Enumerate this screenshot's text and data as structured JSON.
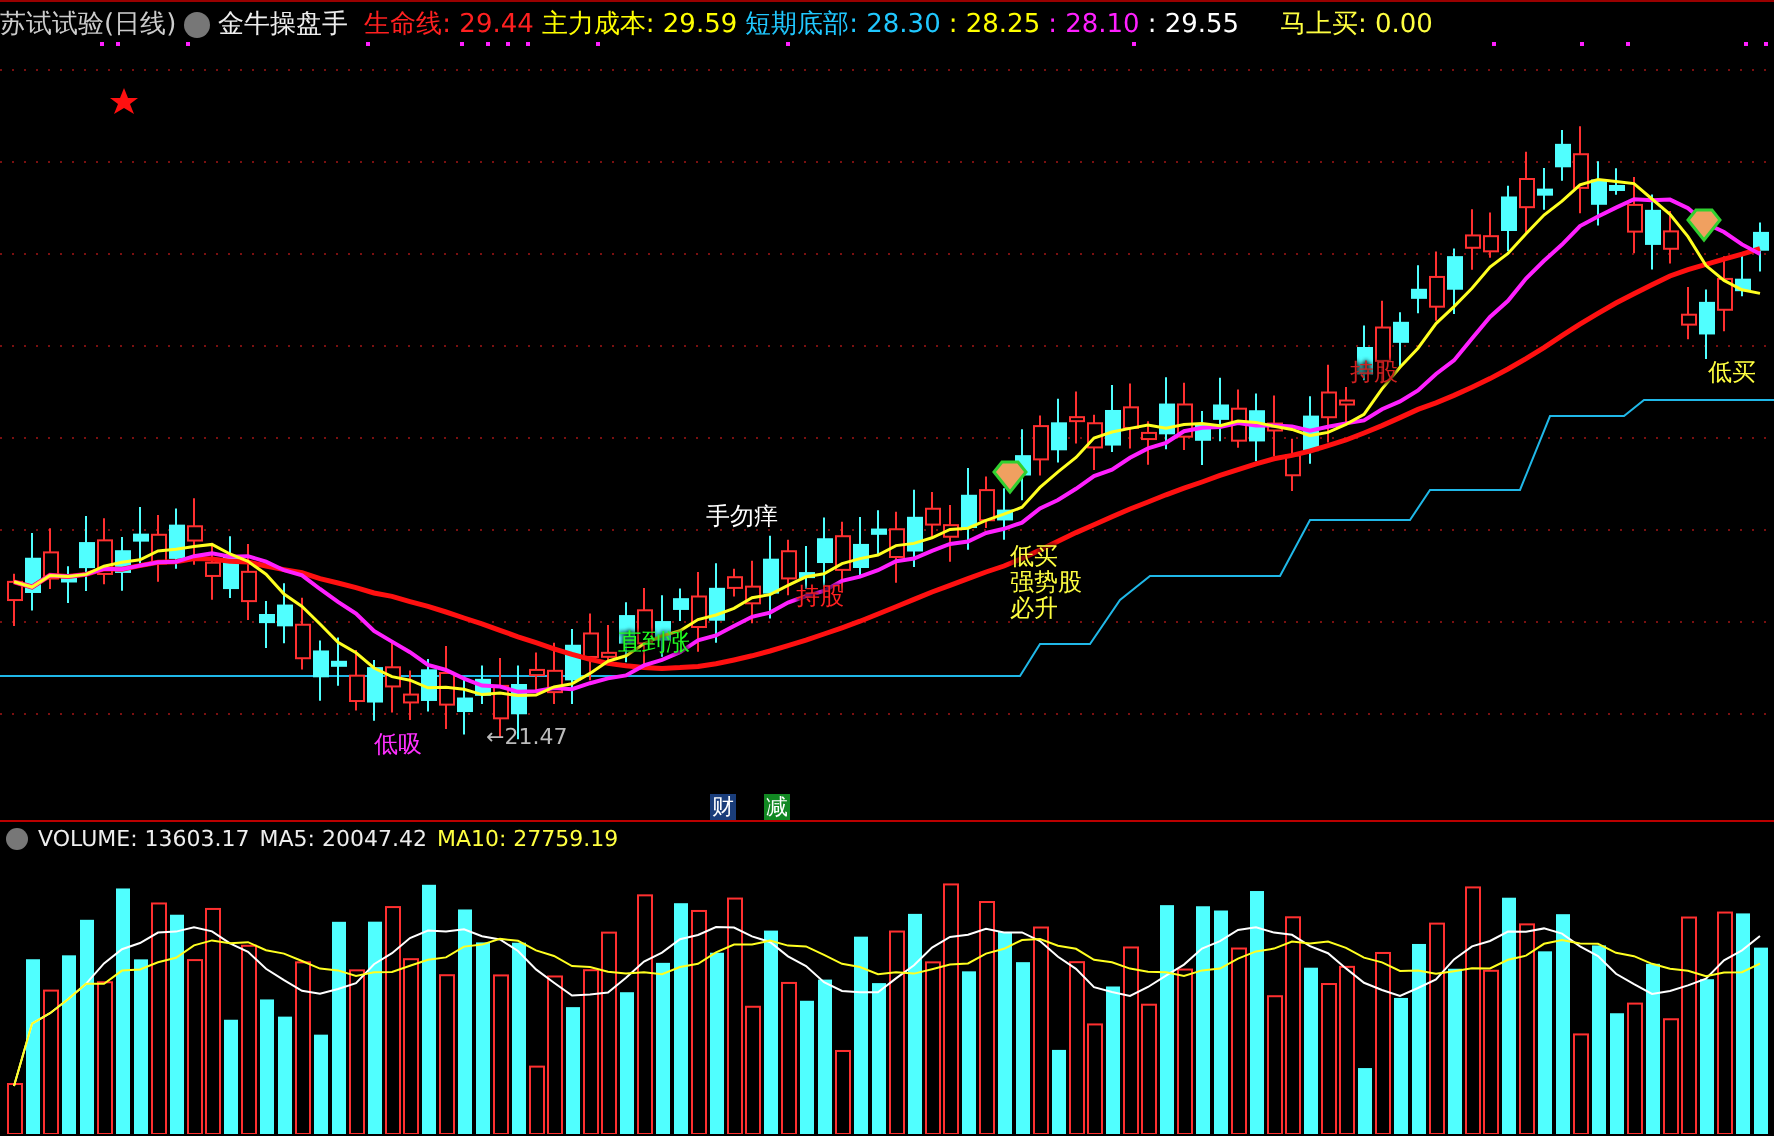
{
  "header": {
    "stock": "苏试试验(日线)",
    "indicator_name": "金牛操盘手",
    "values": [
      {
        "text": "生命线: 29.44",
        "color": "#ff2020"
      },
      {
        "text": "主力成本: 29.59",
        "color": "#ffff00"
      },
      {
        "text": "短期底部: 28.30",
        "color": "#20c8ff"
      },
      {
        "text": ": 28.25",
        "color": "#ffff00"
      },
      {
        "text": ": 28.10",
        "color": "#ff20ff"
      },
      {
        "text": ": 29.55",
        "color": "#ffffff"
      }
    ],
    "buy_now": "马上买: 0.00"
  },
  "annotations": [
    {
      "lines": [
        "手勿痒"
      ],
      "color": "#ffffff"
    },
    {
      "lines": [
        "持股"
      ],
      "color": "#ff2020"
    },
    {
      "lines": [
        "直到涨"
      ],
      "color": "#20ff20"
    },
    {
      "lines": [
        "低吸"
      ],
      "color": "#ff30ff"
    },
    {
      "lines": [
        "低买",
        "强势股",
        "必升"
      ],
      "color": "#ffff40"
    },
    {
      "lines": [
        "持股"
      ],
      "color": "#d02020"
    },
    {
      "lines": [
        "低买"
      ],
      "color": "#ffff40"
    }
  ],
  "low_marker": "←21.47",
  "badges": [
    {
      "text": "财",
      "color": "#1a3d7a"
    },
    {
      "text": "减",
      "color": "#118822"
    }
  ],
  "volume": {
    "label": "VOLUME: 13603.17",
    "ma5": "MA5: 20047.42",
    "ma10": "MA10: 27759.19"
  }
}
